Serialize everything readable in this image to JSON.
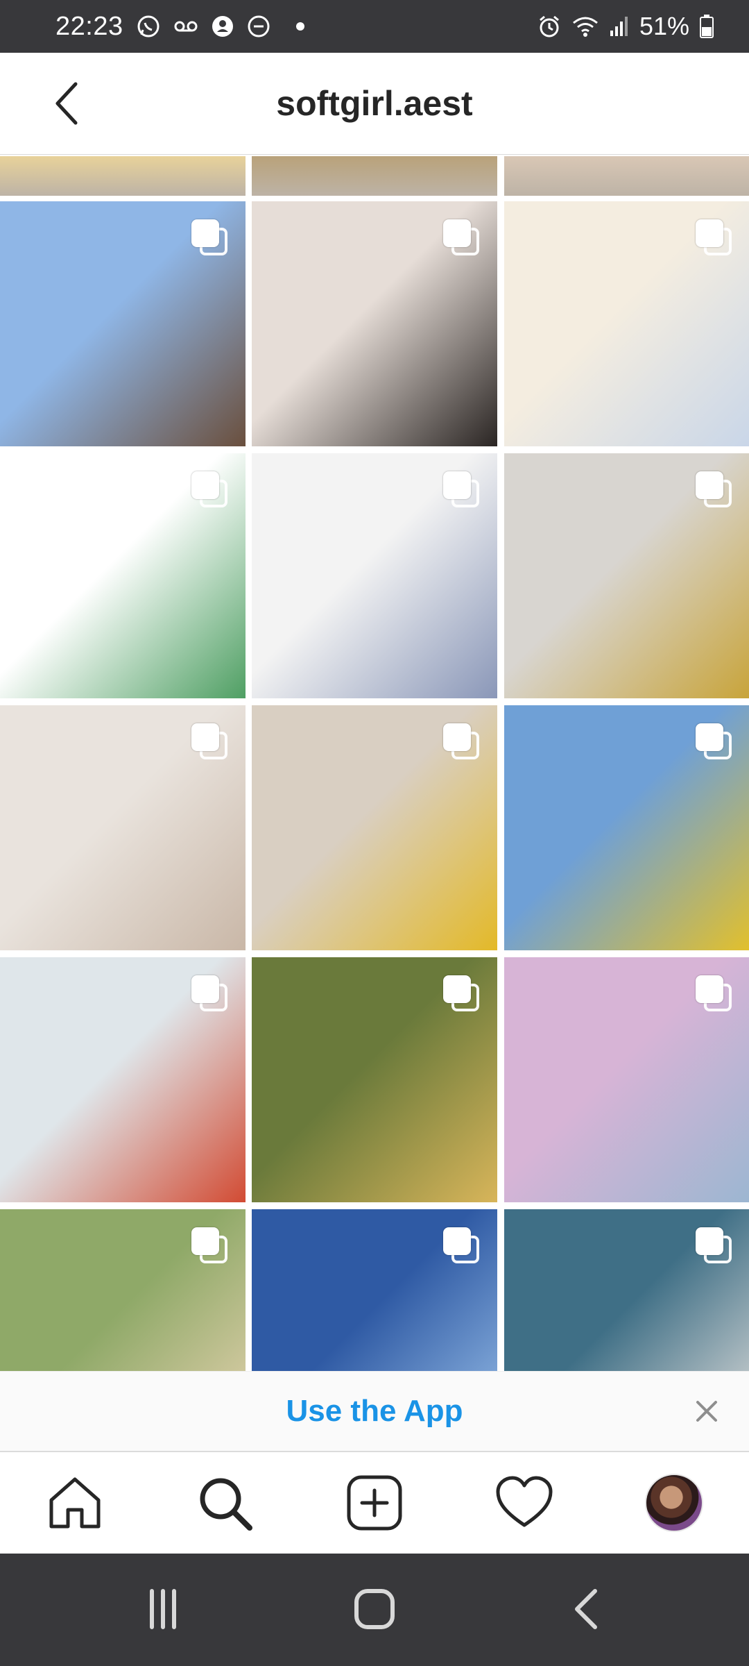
{
  "status_bar": {
    "time": "22:23",
    "battery": "51%",
    "left_icons": [
      "whatsapp-icon",
      "voicemail-icon",
      "account-icon",
      "do-not-disturb-icon",
      "dot-icon"
    ],
    "right_icons": [
      "alarm-icon",
      "wifi-icon",
      "signal-icon",
      "battery-icon"
    ]
  },
  "header": {
    "title": "softgirl.aest"
  },
  "grid": {
    "partial_row_colors": [
      "#e8d29a",
      "#b9a27a",
      "#d9c7b5"
    ],
    "posts": [
      {
        "name": "post-1",
        "colors": [
          "#8fb6e6",
          "#6a4f3d"
        ]
      },
      {
        "name": "post-2",
        "colors": [
          "#e6ddd7",
          "#2a2523"
        ]
      },
      {
        "name": "post-3",
        "colors": [
          "#f4ede0",
          "#c9d6e8"
        ]
      },
      {
        "name": "post-4",
        "colors": [
          "#ffffff",
          "#4f9f63"
        ]
      },
      {
        "name": "post-5",
        "colors": [
          "#f3f3f3",
          "#8a97b8"
        ]
      },
      {
        "name": "post-6",
        "colors": [
          "#d8d5d0",
          "#c8a43a"
        ]
      },
      {
        "name": "post-7",
        "colors": [
          "#e9e3dd",
          "#c9b7a7"
        ]
      },
      {
        "name": "post-8",
        "colors": [
          "#d9cfc2",
          "#e3b928"
        ]
      },
      {
        "name": "post-9",
        "colors": [
          "#6fa0d6",
          "#e2c02c"
        ]
      },
      {
        "name": "post-10",
        "colors": [
          "#dfe6ea",
          "#d24b33"
        ]
      },
      {
        "name": "post-11",
        "colors": [
          "#6a7a3b",
          "#d8b55a"
        ]
      },
      {
        "name": "post-12",
        "colors": [
          "#d7b4d6",
          "#9cb6d1"
        ]
      },
      {
        "name": "post-13",
        "colors": [
          "#8fa968",
          "#e9d4b3"
        ]
      },
      {
        "name": "post-14",
        "colors": [
          "#2f5aa4",
          "#9cc2ea"
        ]
      },
      {
        "name": "post-15",
        "colors": [
          "#3f6f86",
          "#e7e3df"
        ]
      }
    ]
  },
  "banner": {
    "text": "Use the App"
  },
  "bottom_nav": {
    "items": [
      "home-icon",
      "search-icon",
      "new-post-icon",
      "activity-heart-icon",
      "profile-avatar"
    ]
  },
  "system_nav": {
    "items": [
      "recent-apps-icon",
      "home-button-icon",
      "back-icon"
    ]
  },
  "colors": {
    "accent": "#1a93e6",
    "status_bar": "#38383b"
  }
}
